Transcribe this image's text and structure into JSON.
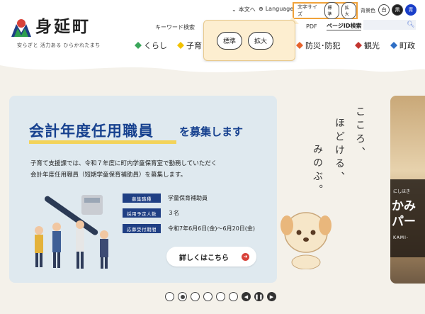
{
  "header": {
    "site_name": "身延町",
    "tagline": "安らぎと 活力ある ひらかれたまち",
    "utility": {
      "honbun": "本文へ",
      "language": "Language",
      "text_size_label": "文字サイズ",
      "text_size_standard": "標準",
      "text_size_large": "拡大",
      "bg_color_label": "背景色",
      "bg_white": "白",
      "bg_black": "黒",
      "bg_blue": "青"
    },
    "keyword_search": "キーワード検索",
    "pdf": "PDF",
    "page_id_search": "ページID検索",
    "page_id_placeholder": ""
  },
  "popup": {
    "standard": "標準",
    "large": "拡大"
  },
  "nav": {
    "kurashi": "くらし",
    "kosodate": "子育",
    "bousai": "防災･防犯",
    "kankou": "観光",
    "chousei": "町政"
  },
  "banner": {
    "title": "会計年度任用職員",
    "title_suffix": "を募集します",
    "desc_line1": "子育て支援課では、令和７年度に町内学童保育室で勤務していただく",
    "desc_line2": "会計年度任用職員（短期学童保育補助員）を募集します。",
    "rows": [
      {
        "key": "募集職種",
        "value": "学童保育補助員"
      },
      {
        "key": "採用予定人数",
        "value": "３名"
      },
      {
        "key": "応募受付期間",
        "value": "令和7年6月6日(金)～6月20日(金)"
      }
    ],
    "detail_button": "詳しくはこちら"
  },
  "slogan": {
    "col1": "こころ、",
    "col2": "ほどける、",
    "col3": "みのぶ。"
  },
  "photo": {
    "small": "にしほき",
    "big": "かみ\nパー",
    "sub": "KAMI-"
  },
  "colors": {
    "accent_orange": "#f0a23a",
    "title_blue": "#17418f",
    "key_navy": "#1f3f84",
    "arrow_red": "#d8423a"
  }
}
